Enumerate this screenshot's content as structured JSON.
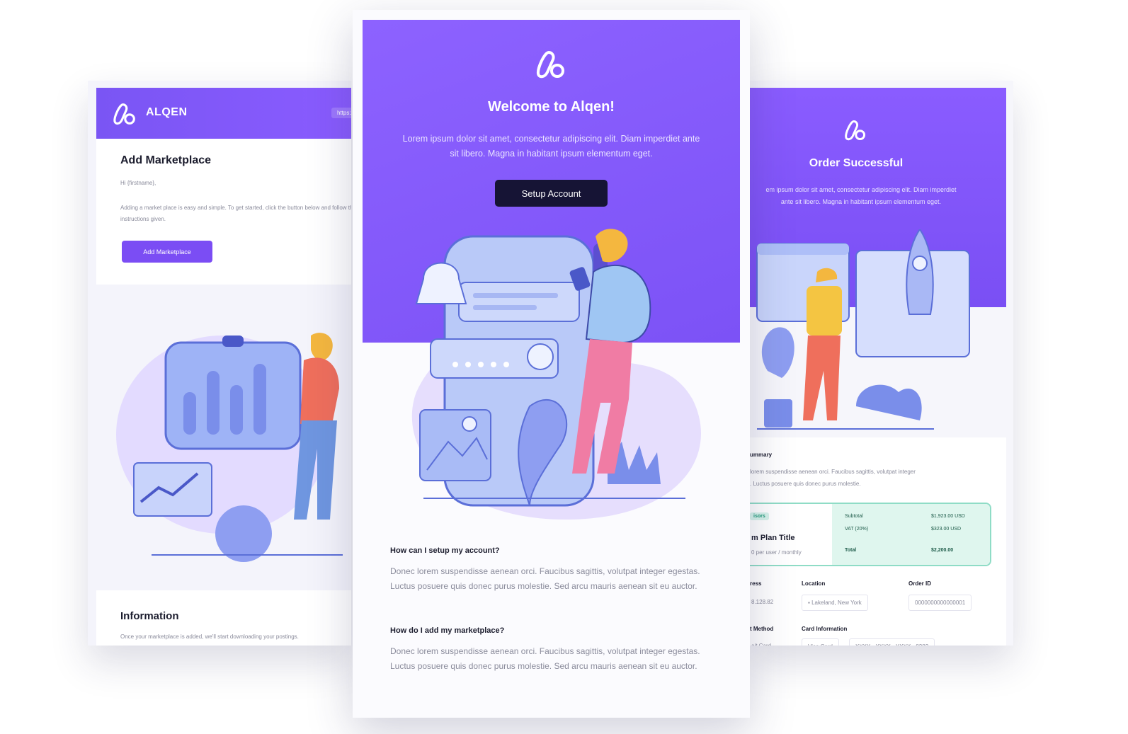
{
  "left_card": {
    "brand": "ALQEN",
    "url_pill": "https://",
    "title": "Add Marketplace",
    "greeting": "Hi {firstname},",
    "paragraph": "Adding a market place is easy and simple. To get started, click the button below and follow the instructions given.",
    "button_label": "Add Marketplace",
    "info_title": "Information",
    "info_text": "Once your marketplace is added, we'll start downloading your postings."
  },
  "center_card": {
    "title": "Welcome to Alqen!",
    "subtitle": "Lorem ipsum dolor sit amet, consectetur adipiscing elit. Diam imperdiet ante sit libero. Magna in habitant ipsum elementum eget.",
    "button_label": "Setup Account",
    "faq": [
      {
        "q": "How can I setup my account?",
        "a": "Donec lorem suspendisse aenean orci. Faucibus sagittis, volutpat integer egestas. Luctus posuere quis donec purus molestie. Sed arcu mauris aenean sit eu auctor."
      },
      {
        "q": "How do I add my marketplace?",
        "a": "Donec lorem suspendisse aenean orci. Faucibus sagittis, volutpat integer egestas. Luctus posuere quis donec purus molestie. Sed arcu mauris aenean sit eu auctor."
      }
    ]
  },
  "right_card": {
    "title": "Order Successful",
    "subtitle_line1": "em ipsum dolor sit amet, consectetur adipiscing elit. Diam imperdiet",
    "subtitle_line2": "ante sit libero. Magna in habitant ipsum elementum eget.",
    "summary_heading": "ummary",
    "summary_line1": "lorem suspendisse aenean orci. Faucibus sagittis, volutpat integer",
    "summary_line2": ". Luctus posuere quis donec purus molestie.",
    "badge": "isors",
    "plan_title": "m Plan Title",
    "plan_sub": "0 per user / monthly",
    "subtotal_label": "Subtotal",
    "subtotal_value": "$1,923.00 USD",
    "vat_label": "VAT (20%)",
    "vat_value": "$323.00 USD",
    "total_label": "Total",
    "total_value": "$2,200.00",
    "addr_label": "ress",
    "addr_value": "8.128.82",
    "location_label": "Location",
    "location_value": "Lakeland, New York",
    "order_id_label": "Order ID",
    "order_id_value": "0000000000000001",
    "payment_label": "t Method",
    "payment_value": "ait Card",
    "card_label": "Card Information",
    "card_brand": "Visa Card",
    "card_number": "XXXX - XXXX - XXXX - 8282"
  },
  "colors": {
    "brand_purple": "#7c52f6",
    "button_dark": "#161435",
    "mint": "#8fdcc6"
  }
}
